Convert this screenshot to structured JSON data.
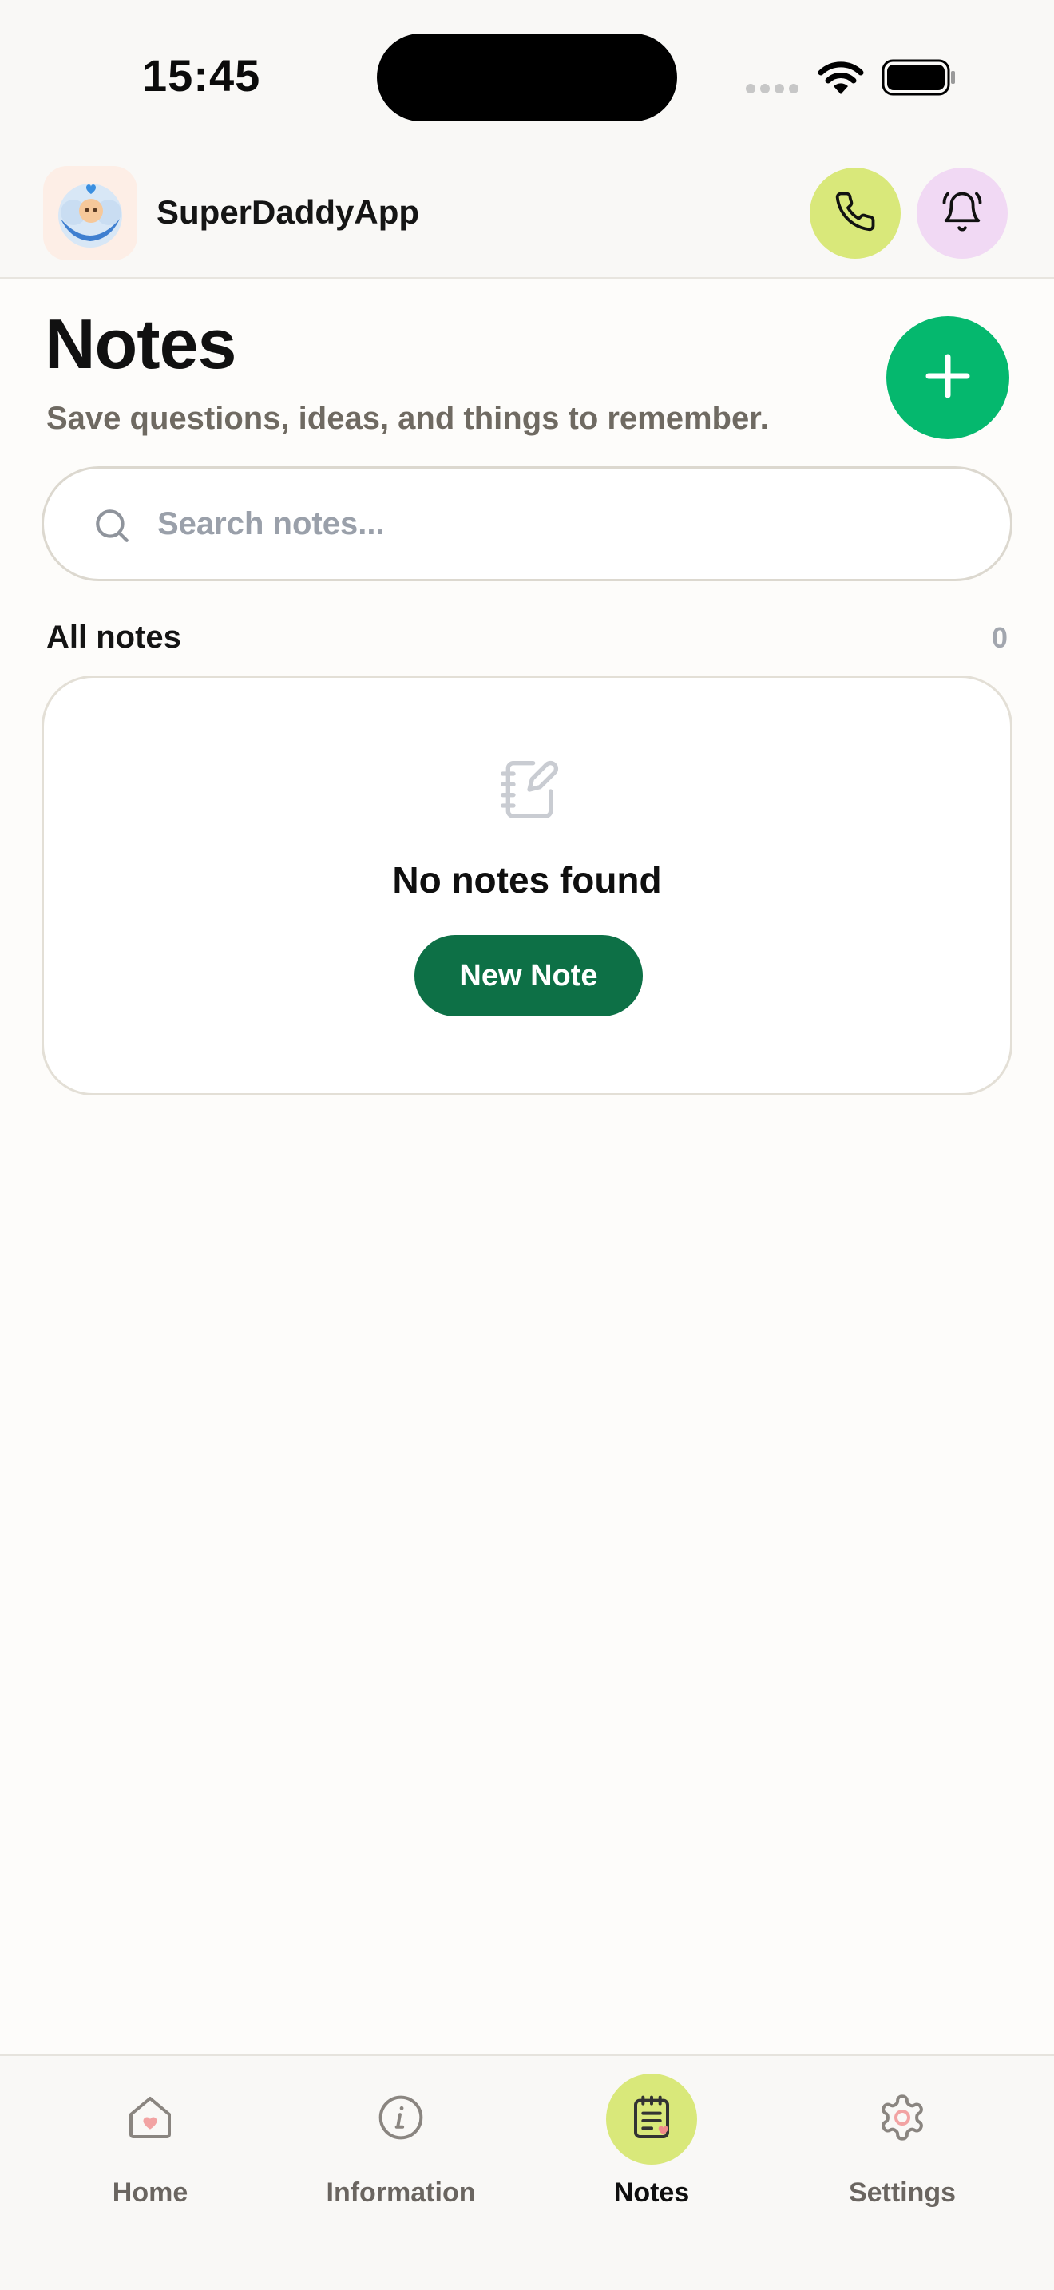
{
  "status_bar": {
    "time": "15:45"
  },
  "header": {
    "app_name": "SuperDaddyApp",
    "call_icon": "phone-icon",
    "notifications_icon": "bell-icon"
  },
  "main": {
    "title": "Notes",
    "subtitle": "Save questions, ideas, and things to remember.",
    "add_icon": "plus-icon",
    "search": {
      "placeholder": "Search notes...",
      "value": ""
    },
    "section": {
      "label": "All notes",
      "count": "0"
    },
    "empty_state": {
      "icon": "notebook-edit-icon",
      "title": "No notes found",
      "button_label": "New Note"
    }
  },
  "bottom_nav": {
    "items": [
      {
        "label": "Home",
        "icon": "home-heart-icon",
        "active": false
      },
      {
        "label": "Information",
        "icon": "info-icon",
        "active": false
      },
      {
        "label": "Notes",
        "icon": "notes-icon",
        "active": true
      },
      {
        "label": "Settings",
        "icon": "gear-icon",
        "active": false
      }
    ]
  },
  "colors": {
    "accent_green": "#05b86e",
    "button_dark_green": "#0d7046",
    "lime": "#d9e87a",
    "lilac": "#f1d9f4"
  }
}
